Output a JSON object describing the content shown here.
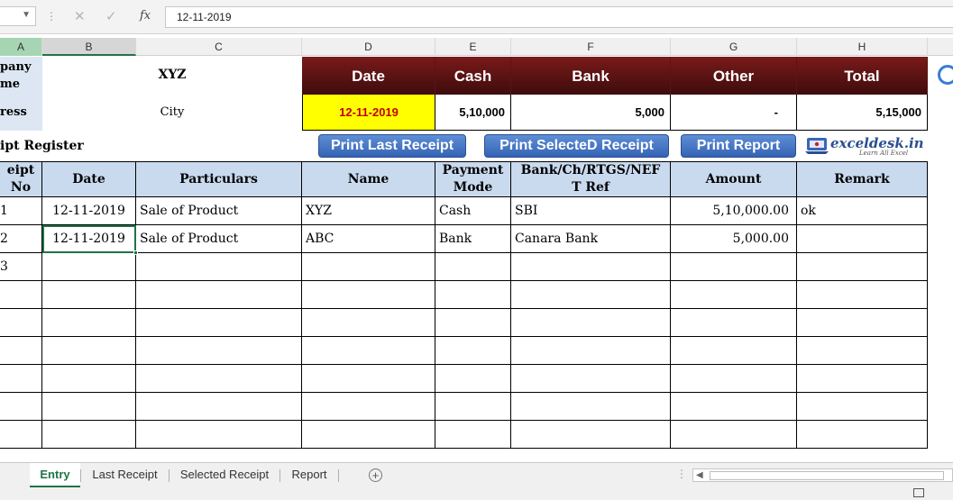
{
  "formula_bar": {
    "name_box": "",
    "cancel_icon": "✕",
    "enter_icon": "✓",
    "fx_label": "fx",
    "value": "12-11-2019"
  },
  "columns": [
    "A",
    "B",
    "C",
    "D",
    "E",
    "F",
    "G",
    "H"
  ],
  "company": {
    "name_label": "pany\nme",
    "name_value": "XYZ",
    "address_label": "ress",
    "address_value": "City"
  },
  "summary": {
    "headers": [
      "Date",
      "Cash",
      "Bank",
      "Other",
      "Total"
    ],
    "values": [
      "12-11-2019",
      "5,10,000",
      "5,000",
      "-",
      "5,15,000"
    ]
  },
  "register_title": "ipt Register",
  "buttons": {
    "print_last": "Print Last Receipt",
    "print_selected": "Print SelecteD Receipt",
    "print_report": "Print Report"
  },
  "logo": {
    "text": "exceldesk.in",
    "tagline": "Learn All Excel"
  },
  "table": {
    "headers": [
      "eipt\nNo",
      "Date",
      "Particulars",
      "Name",
      "Payment\nMode",
      "Bank/Ch/RTGS/NEF\nT Ref",
      "Amount",
      "Remark"
    ],
    "rows": [
      [
        "1",
        "12-11-2019",
        "Sale of Product",
        "XYZ",
        "Cash",
        "SBI",
        "5,10,000.00",
        "ok"
      ],
      [
        "2",
        "12-11-2019",
        "Sale of Product",
        "ABC",
        "Bank",
        "Canara Bank",
        "5,000.00",
        ""
      ],
      [
        "3",
        "",
        "",
        "",
        "",
        "",
        "",
        ""
      ],
      [
        "",
        "",
        "",
        "",
        "",
        "",
        "",
        ""
      ],
      [
        "",
        "",
        "",
        "",
        "",
        "",
        "",
        ""
      ],
      [
        "",
        "",
        "",
        "",
        "",
        "",
        "",
        ""
      ],
      [
        "",
        "",
        "",
        "",
        "",
        "",
        "",
        ""
      ],
      [
        "",
        "",
        "",
        "",
        "",
        "",
        "",
        ""
      ],
      [
        "",
        "",
        "",
        "",
        "",
        "",
        "",
        ""
      ]
    ]
  },
  "sheet_tabs": [
    "Entry",
    "Last Receipt",
    "Selected Receipt",
    "Report"
  ],
  "active_tab": "Entry",
  "colors": {
    "accent": "#217346",
    "header_dark": "#5a1010",
    "date_highlight": "#ffff00",
    "date_text": "#c00000",
    "button_blue": "#4a7bc8",
    "table_header": "#c9daef"
  }
}
